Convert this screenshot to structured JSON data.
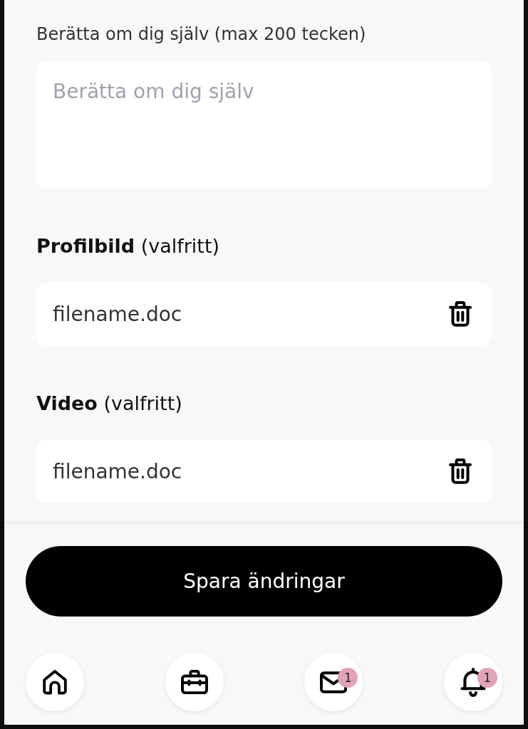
{
  "bio": {
    "label": "Berätta om dig själv (max 200 tecken)",
    "placeholder": "Berätta om dig själv"
  },
  "uploads": [
    {
      "label": "**Profilbild** (valfritt)",
      "filename": "filename.doc"
    },
    {
      "label": "**Video** (valfritt)",
      "filename": "filename.doc"
    }
  ],
  "save_button": "Spara ändringar",
  "bottom_nav": [
    {
      "kind": "home"
    },
    {
      "kind": "briefcase"
    },
    {
      "kind": "mail",
      "badge": "1"
    },
    {
      "kind": "bell",
      "badge": "1"
    }
  ]
}
